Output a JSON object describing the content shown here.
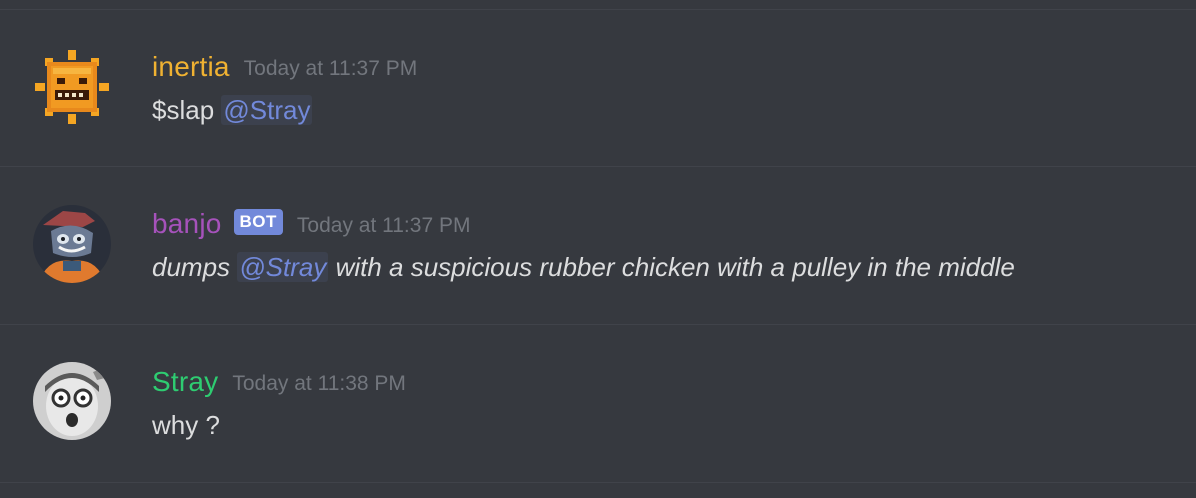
{
  "messages": [
    {
      "username": "inertia",
      "username_color": "#f0b232",
      "timestamp": "Today at 11:37 PM",
      "avatar": "pumpkin-sun-avatar",
      "content_prefix": "$slap ",
      "mention": "@Stray",
      "content_suffix": "",
      "italic": false
    },
    {
      "username": "banjo",
      "username_color": "#a652bb",
      "bot_tag": "BOT",
      "timestamp": "Today at 11:37 PM",
      "avatar": "banjo-character-avatar",
      "content_prefix": "dumps ",
      "mention": "@Stray",
      "content_suffix": " with a suspicious rubber chicken with a pulley in the middle",
      "italic": true
    },
    {
      "username": "Stray",
      "username_color": "#2ecc71",
      "timestamp": "Today at 11:38 PM",
      "avatar": "stray-grayscale-avatar",
      "content": "why ?",
      "italic": false
    }
  ],
  "colors": {
    "background": "#36393f",
    "mention": "#7289da",
    "timestamp": "#72767d",
    "text": "#dcddde"
  }
}
